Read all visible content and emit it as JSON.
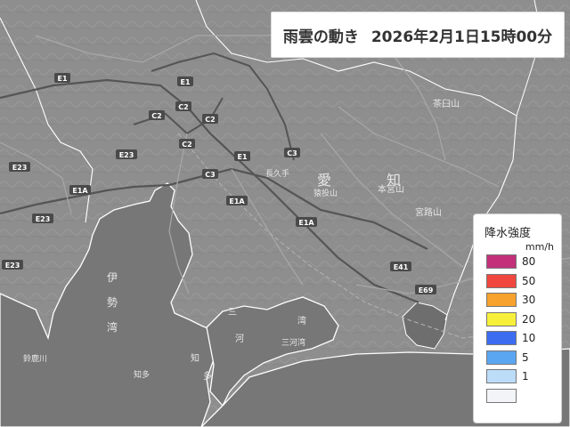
{
  "title": {
    "heading": "雨雲の動き",
    "timestamp": "2026年2月1日15時00分"
  },
  "legend": {
    "title": "降水強度",
    "unit": "mm/h",
    "levels": [
      {
        "label": "80",
        "color": "#c2317a"
      },
      {
        "label": "50",
        "color": "#f0473f"
      },
      {
        "label": "30",
        "color": "#f6a22c"
      },
      {
        "label": "20",
        "color": "#f7f03b"
      },
      {
        "label": "10",
        "color": "#3c6df0"
      },
      {
        "label": "5",
        "color": "#5aa6f0"
      },
      {
        "label": "1",
        "color": "#bcdcf8"
      },
      {
        "label": "",
        "color": "#f2f4f8"
      }
    ]
  },
  "map": {
    "region_labels": [
      "愛",
      "知"
    ],
    "road_labels": [
      "C2",
      "C2",
      "C2",
      "C2",
      "C3",
      "C3",
      "E1",
      "E1",
      "E1",
      "E1A",
      "E1A",
      "E1A",
      "E23",
      "E23",
      "E23",
      "E23",
      "E69",
      "E41"
    ],
    "place_labels": [
      "伊",
      "勢",
      "湾",
      "三",
      "河",
      "湾",
      "知",
      "多",
      "茶臼山",
      "宮路山",
      "本宮山",
      "猿投山",
      "長久手",
      "知多",
      "鈴鹿川",
      "三河湾"
    ],
    "colors": {
      "land": "#8e8e8e",
      "sea": "#767676",
      "coast": "#ffffff",
      "road": "#a6a6a6",
      "expressway": "#555555"
    }
  }
}
